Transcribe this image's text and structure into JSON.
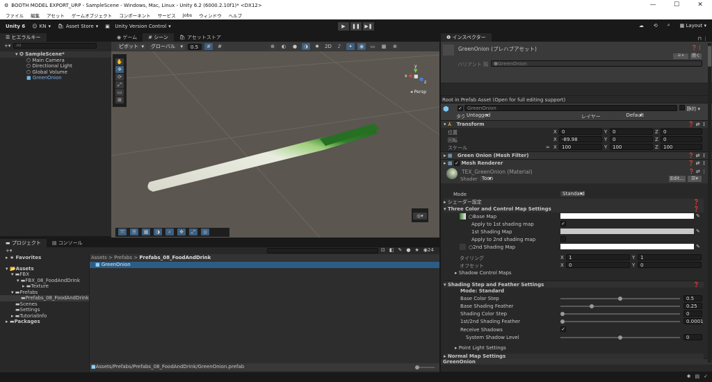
{
  "window": {
    "title": "BOOTH MODEL EXPORT_URP - SampleScene - Windows, Mac, Linux - Unity 6.2 (6000.2.10f1)* <DX12>",
    "minimize": "—",
    "maximize": "☐",
    "close": "✕"
  },
  "menu": [
    "ファイル",
    "編集",
    "アセット",
    "ゲームオブジェクト",
    "コンポーネント",
    "サービス",
    "Jobs",
    "ウィンドウ",
    "ヘルプ"
  ],
  "toolbar": {
    "unity": "Unity 6",
    "account": "KN",
    "asset_store": "Asset Store",
    "version_control": "Unity Version Control",
    "layout": "Layout"
  },
  "hierarchy": {
    "tab": "ヒエラルキー",
    "search_placeholder": "All",
    "scene": "SampleScene*",
    "items": [
      "Main Camera",
      "Directional Light",
      "Global Volume",
      "GreenOnion"
    ]
  },
  "scene": {
    "tabs": [
      "ゲーム",
      "シーン",
      "アセットストア"
    ],
    "pivot": "ピボット",
    "global": "グローバル",
    "snap": "0.5",
    "persp": "Persp",
    "gizmo_x": "x",
    "gizmo_y": "y",
    "gizmo_z": "z"
  },
  "project": {
    "tabs": [
      "プロジェクト",
      "コンソール"
    ],
    "favorites": "Favorites",
    "tree": [
      "Assets",
      "FBX",
      "FBX_08_FoodAndDrink",
      "Texture",
      "Prefabs",
      "Prefabs_08_FoodAndDrink",
      "Scenes",
      "Settings",
      "TutorialInfo",
      "Packages"
    ],
    "breadcrumb": [
      "Assets",
      "Prefabs",
      "Prefabs_08_FoodAndDrink"
    ],
    "files": [
      "GreenOnion"
    ],
    "path": "Assets/Prefabs/Prefabs_08_FoodAndDrink/GreenOnion.prefab",
    "hidden_count": "24"
  },
  "inspector": {
    "tab": "インスペクター",
    "title": "GreenOnion (プレハブアセット)",
    "open": "開く",
    "variant_label": "バリアント 親",
    "variant_value": "GreenOnion",
    "root_note": "Root in Prefab Asset (Open for full editing support)",
    "name": "GreenOnion",
    "static": "静的",
    "tag_label": "タグ",
    "tag": "Untagged",
    "layer_label": "レイヤー",
    "layer": "Default",
    "transform": {
      "title": "Transform",
      "rows": [
        {
          "label": "位置",
          "x": "0",
          "y": "0",
          "z": "0"
        },
        {
          "label": "回転",
          "x": "-89.98",
          "y": "0",
          "z": "0"
        },
        {
          "label": "スケール",
          "x": "100",
          "y": "100",
          "z": "100"
        }
      ]
    },
    "mesh_filter": "Green Onion (Mesh Filter)",
    "mesh_renderer": "Mesh Renderer",
    "material": "TEX_GreenOnion (Material)",
    "shader_label": "Shader",
    "shader": "Toon",
    "edit": "Edit...",
    "mode_label": "Mode",
    "mode": "Standard",
    "shader_settings": "シェーダー設定",
    "three_color": "Three Color and Control Map Settings",
    "base_map": "Base Map",
    "apply1": "Apply to 1st shading map",
    "first_map": "1st Shading Map",
    "apply2": "Apply to 2nd shading map",
    "second_map": "2nd Shading Map",
    "tiling_label": "タイリング",
    "tiling_x": "1",
    "tiling_y": "1",
    "offset_label": "オフセット",
    "offset_x": "0",
    "offset_y": "0",
    "shadow_control": "Shadow Control Maps",
    "shading_step": "Shading Step and Feather Settings",
    "step_mode": "Mode: Standard",
    "sliders": [
      {
        "label": "Base Color Step",
        "value": "0.5",
        "frac": 0.5
      },
      {
        "label": "Base Shading Feather",
        "value": "0.25",
        "frac": 0.25
      },
      {
        "label": "Shading Color Step",
        "value": "0",
        "frac": 0
      },
      {
        "label": "1st/2nd Shading Feather",
        "value": "0.0001",
        "frac": 0
      }
    ],
    "receive_shadows": "Receive Shadows",
    "system_shadow": "System Shadow Level",
    "system_shadow_value": "0",
    "system_shadow_frac": 0.5,
    "point_light": "Point Light Settings",
    "normal_map": "Normal Map Settings",
    "footer": "GreenOnion"
  }
}
